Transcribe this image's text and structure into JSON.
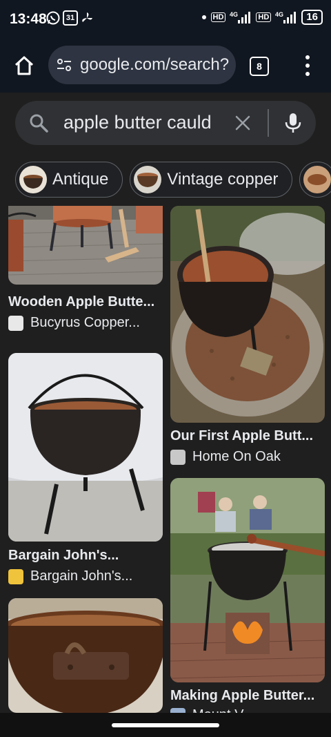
{
  "status_bar": {
    "time": "13:48",
    "left_icons": [
      "whatsapp-icon",
      "calendar-icon",
      "fan-icon"
    ],
    "right_icons": [
      "dot",
      "hd-icon",
      "4g-signal-icon",
      "hd-icon",
      "4g-signal-icon"
    ],
    "calendar_day": "31",
    "network_label": "4G",
    "hd_label": "HD",
    "battery": "16"
  },
  "browser": {
    "url": "google.com/search?",
    "tab_count": "8"
  },
  "search": {
    "query": "apple butter cauld"
  },
  "chips": [
    {
      "label": "Antique"
    },
    {
      "label": "Vintage copper"
    }
  ],
  "results": [
    {
      "title": "Wooden Apple Butte...",
      "source": "Bucyrus Copper..."
    },
    {
      "title": "Our First Apple Butt...",
      "source": "Home On Oak"
    },
    {
      "title": "Bargain John's...",
      "source": "Bargain John's..."
    },
    {
      "title": "Making Apple Butter...",
      "source": "Mount V..."
    }
  ],
  "colors": {
    "background": "#1f1f1f",
    "top_bar": "#111720",
    "url_pill": "#2e3441",
    "search_box": "#303134",
    "text": "#e8eaed"
  }
}
